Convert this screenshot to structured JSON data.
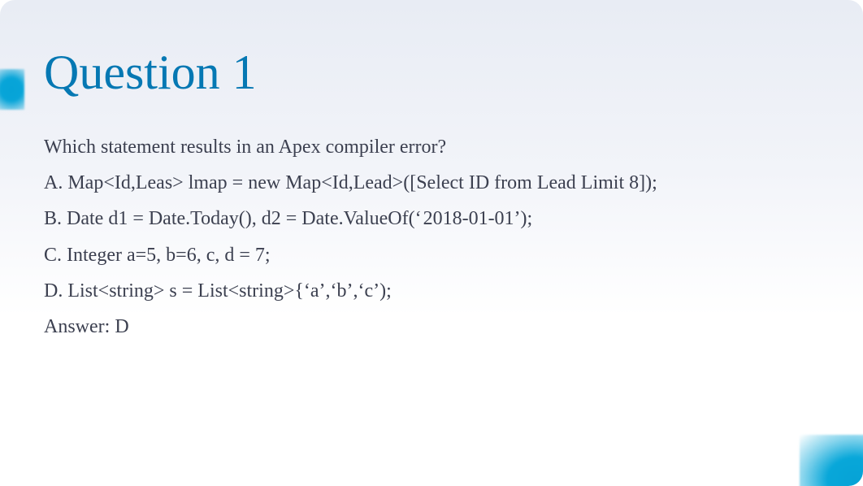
{
  "slide": {
    "title": "Question 1",
    "question": "Which statement results in an Apex compiler error?",
    "options": [
      "A. Map<Id,Leas> lmap = new Map<Id,Lead>([Select ID from Lead Limit 8]);",
      "B. Date d1 = Date.Today(), d2 = Date.ValueOf(‘ 2018-01-01’);",
      "C. Integer a=5, b=6, c, d = 7;",
      "D. List<string> s = List<string>{‘a’,‘b’,‘c’);"
    ],
    "answer": "Answer: D"
  }
}
